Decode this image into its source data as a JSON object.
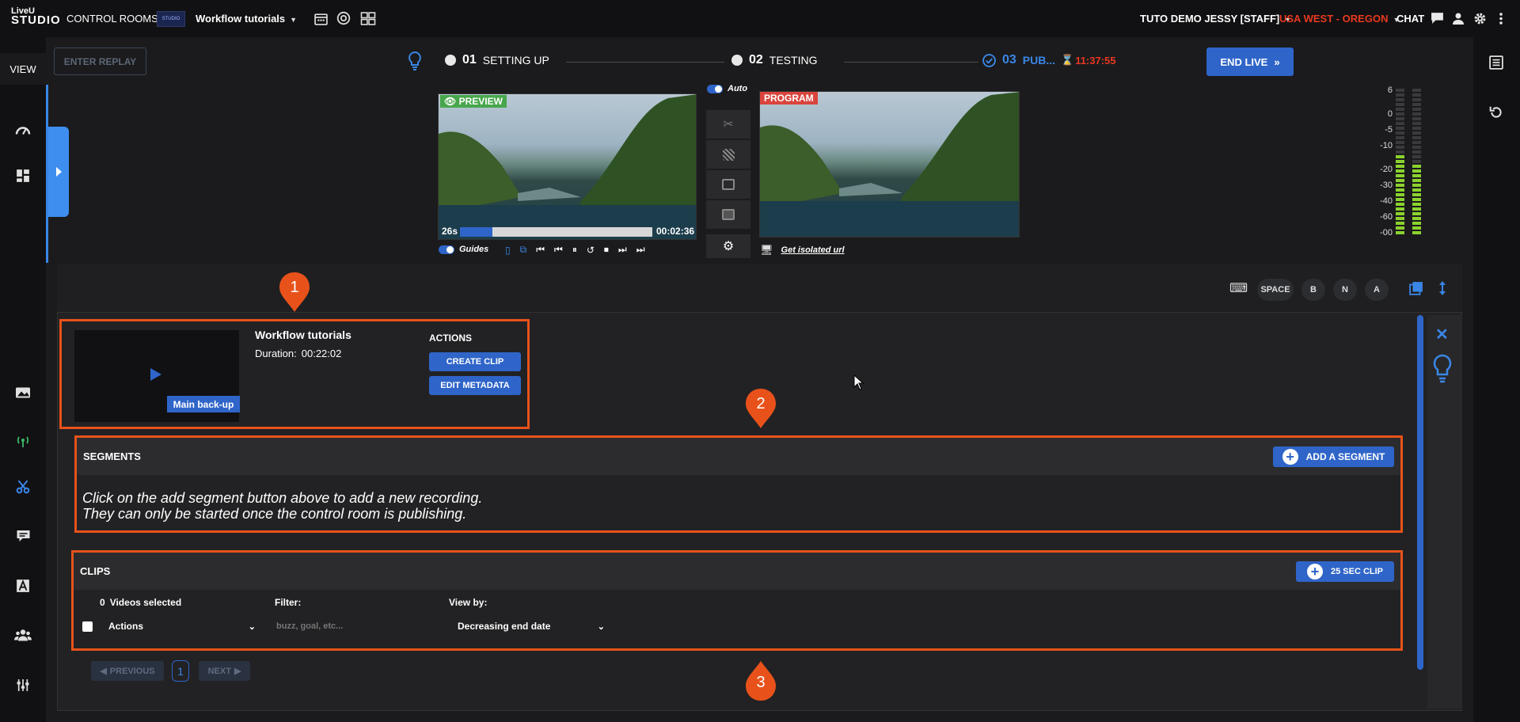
{
  "topbar": {
    "logo_line1": "LiveU",
    "logo_line2": "STUDIO",
    "control_rooms": "CONTROL ROOMS",
    "thumb_text": "STUDIO",
    "room_name": "Workflow tutorials",
    "user": "TUTO DEMO JESSY [STAFF]",
    "region": "USA WEST - OREGON",
    "chat": "CHAT",
    "region_color": "#e8391f"
  },
  "leftnav": {
    "view_label": "VIEW"
  },
  "workflow": {
    "enter_replay": "ENTER REPLAY",
    "step1_num": "01",
    "step1_label": "SETTING UP",
    "step2_num": "02",
    "step2_label": "TESTING",
    "step3_num": "03",
    "step3_label": "PUB...",
    "timer": "11:37:55",
    "end_live": "END LIVE",
    "auto_label": "Auto",
    "accent": "#2f65c9"
  },
  "preview": {
    "tag": "PREVIEW",
    "elapsed": "26s",
    "duration": "00:02:36",
    "progress": 0.17,
    "guides_label": "Guides"
  },
  "program": {
    "tag": "PROGRAM",
    "isolated_link": "Get isolated url"
  },
  "audio_meter": {
    "scale": [
      "6",
      "0",
      "-5",
      "-10",
      "-20",
      "-30",
      "-40",
      "-60",
      "-00"
    ]
  },
  "toolbar": {
    "shortcuts": [
      "SPACE",
      "B",
      "N",
      "A"
    ]
  },
  "media": {
    "title": "Workflow tutorials",
    "duration_label": "Duration:",
    "duration_value": "00:22:02",
    "badge": "Main back-up",
    "actions_title": "ACTIONS",
    "create_clip": "CREATE CLIP",
    "edit_metadata": "EDIT METADATA"
  },
  "segments": {
    "title": "SEGMENTS",
    "add_button": "ADD A SEGMENT",
    "message_line1": "Click on the add segment button above to add a new recording.",
    "message_line2": "They can only be started once the control room is publishing."
  },
  "clips": {
    "title": "CLIPS",
    "clip_button": "25 SEC CLIP",
    "selected_count": "0",
    "selected_label": "Videos selected",
    "filter_label": "Filter:",
    "filter_placeholder": "buzz, goal, etc...",
    "viewby_label": "View by:",
    "actions_option": "Actions",
    "viewby_option": "Decreasing end date"
  },
  "pagination": {
    "previous": "PREVIOUS",
    "page": "1",
    "next": "NEXT"
  },
  "markers": [
    "1",
    "2",
    "3"
  ],
  "annotation_color": "#e8521a"
}
